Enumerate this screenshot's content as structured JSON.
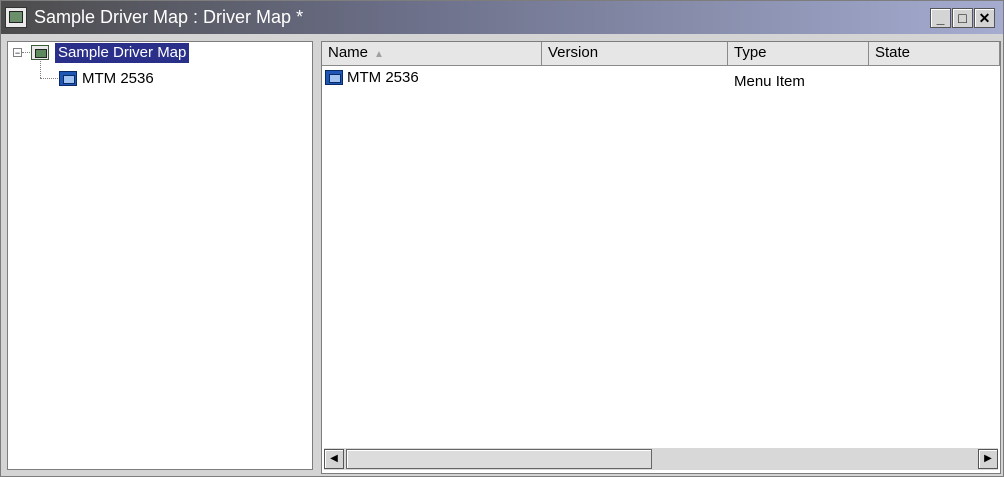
{
  "window": {
    "title": "Sample Driver Map : Driver Map *",
    "minimize_glyph": "_",
    "maximize_glyph": "□",
    "close_glyph": "✕"
  },
  "tree": {
    "root": {
      "label": "Sample Driver Map",
      "expanded": true,
      "expander_glyph": "−",
      "icon": "driver-map-icon"
    },
    "children": [
      {
        "label": "MTM 2536",
        "icon": "menu-item-icon"
      }
    ]
  },
  "table": {
    "columns": [
      {
        "label": "Name",
        "sort": "ascending",
        "sort_glyph": "▲"
      },
      {
        "label": "Version"
      },
      {
        "label": "Type"
      },
      {
        "label": "State"
      }
    ],
    "rows": [
      {
        "name": "MTM 2536",
        "version": "",
        "type": "Menu Item",
        "state": "",
        "icon": "menu-item-icon"
      }
    ]
  },
  "scrollbar": {
    "left_arrow": "◀",
    "right_arrow": "▶"
  },
  "colors": {
    "selection": "#2a2f8a",
    "menu_icon": "#1e56b5"
  }
}
